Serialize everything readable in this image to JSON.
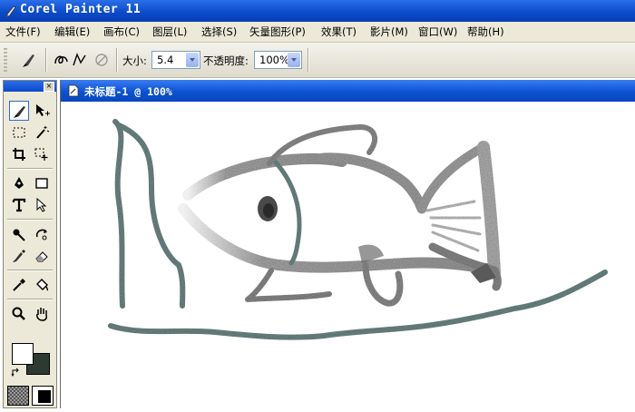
{
  "app": {
    "title": "Corel Painter 11"
  },
  "menu": [
    {
      "name": "menu-file",
      "label": "文件(F)"
    },
    {
      "name": "menu-edit",
      "label": "编辑(E)"
    },
    {
      "name": "menu-canvas",
      "label": "画布(C)"
    },
    {
      "name": "menu-layers",
      "label": "图层(L)"
    },
    {
      "name": "menu-select",
      "label": "选择(S)"
    },
    {
      "name": "menu-shapes",
      "label": "矢量图形(P)"
    },
    {
      "name": "menu-effects",
      "label": "效果(T)"
    },
    {
      "name": "menu-movie",
      "label": "影片(M)"
    },
    {
      "name": "menu-window",
      "label": "窗口(W)"
    },
    {
      "name": "menu-help",
      "label": "帮助(H)"
    }
  ],
  "property_bar": {
    "size_label": "大小:",
    "size_value": "5.4",
    "opacity_label": "不透明度:",
    "opacity_value": "100%"
  },
  "document": {
    "title": "未标题-1 @ 100%"
  },
  "colors": {
    "primary_color": "#ffffff",
    "secondary_color": "#2d3a32",
    "title_bar": "#0a49c8",
    "stroke_gray": "#9a9a9a",
    "stroke_teal": "#6f8a88"
  },
  "icons": {
    "brush_tool": "brush-icon",
    "transform_tool": "layer-adjuster-icon",
    "rect_select": "rectangular-selection-icon",
    "magic_wand": "magic-wand-icon",
    "crop": "crop-icon",
    "lasso_move": "selection-adjuster-icon",
    "pen": "pen-icon",
    "rectangle": "rectangle-shape-icon",
    "text": "text-icon",
    "shape_select": "shape-selection-icon",
    "dropper_blend": "dodge-icon",
    "rotate": "rotate-page-icon",
    "cloner": "cloner-icon",
    "eraser": "eraser-icon",
    "eyedropper": "dropper-icon",
    "paint_bucket": "paint-bucket-icon",
    "magnifier": "magnifier-icon",
    "grabber": "grabber-hand-icon"
  }
}
